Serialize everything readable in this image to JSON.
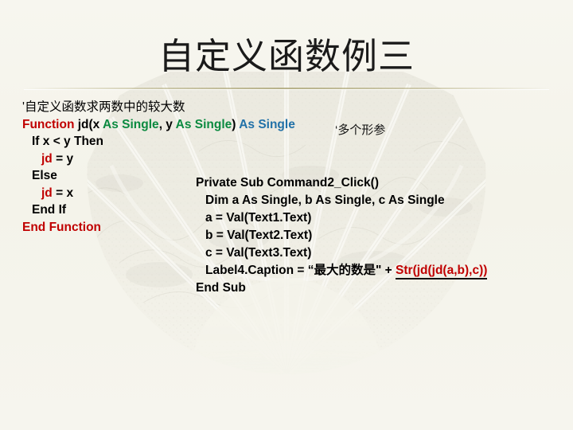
{
  "slide": {
    "title": "自定义函数例三",
    "background_color": "#f4f3ea",
    "band_color": "#c3bc87",
    "watermark": "folding-fan-landscape-painting"
  },
  "palette": {
    "keyword_red": "#c00000",
    "type_green": "#0b8a40",
    "type_blue": "#2171a8",
    "text_black": "#000000"
  },
  "code_left": {
    "name": "user-defined-function-jd",
    "lines": [
      {
        "indent": 0,
        "parts": [
          {
            "text": "'自定义函数求两数中的较大数",
            "style": "cmt"
          }
        ]
      },
      {
        "indent": 0,
        "parts": [
          {
            "text": "Function ",
            "style": "red"
          },
          {
            "text": "jd(x ",
            "style": "bold"
          },
          {
            "text": "As Single",
            "style": "green"
          },
          {
            "text": ", y ",
            "style": "bold"
          },
          {
            "text": "As Single",
            "style": "green"
          },
          {
            "text": ") ",
            "style": "bold"
          },
          {
            "text": "As Single",
            "style": "blue"
          }
        ]
      },
      {
        "indent": 1,
        "parts": [
          {
            "text": "If x < y Then",
            "style": "bold"
          }
        ]
      },
      {
        "indent": 2,
        "parts": [
          {
            "text": "jd",
            "style": "red"
          },
          {
            "text": " = y",
            "style": "bold"
          }
        ]
      },
      {
        "indent": 1,
        "parts": [
          {
            "text": "Else",
            "style": "bold"
          }
        ]
      },
      {
        "indent": 2,
        "parts": [
          {
            "text": "jd",
            "style": "red"
          },
          {
            "text": " = x",
            "style": "bold"
          }
        ]
      },
      {
        "indent": 1,
        "parts": [
          {
            "text": "End If",
            "style": "bold"
          }
        ]
      },
      {
        "indent": 0,
        "parts": [
          {
            "text": "End Function",
            "style": "red"
          }
        ]
      }
    ]
  },
  "header_comment": {
    "text": "‘多个形参"
  },
  "code_right": {
    "name": "command2-click-handler",
    "lines": [
      {
        "indent": 0,
        "parts": [
          {
            "text": "Private Sub Command2_Click()",
            "style": "bold"
          }
        ]
      },
      {
        "indent": 1,
        "parts": [
          {
            "text": "Dim a As Single, b As Single, c As Single",
            "style": "bold"
          }
        ]
      },
      {
        "indent": 1,
        "parts": [
          {
            "text": "a = Val(Text1.Text)",
            "style": "bold"
          }
        ]
      },
      {
        "indent": 1,
        "parts": [
          {
            "text": "b = Val(Text2.Text)",
            "style": "bold"
          }
        ]
      },
      {
        "indent": 1,
        "parts": [
          {
            "text": "c = Val(Text3.Text)",
            "style": "bold"
          }
        ]
      },
      {
        "indent": 1,
        "parts": [
          {
            "text": "Label4.Caption = “最大的数是\" + ",
            "style": "bold"
          },
          {
            "text": "Str(jd(jd(a,b),c))",
            "style": "underlined"
          }
        ]
      },
      {
        "indent": 0,
        "parts": [
          {
            "text": "End Sub",
            "style": "bold"
          }
        ]
      }
    ]
  }
}
